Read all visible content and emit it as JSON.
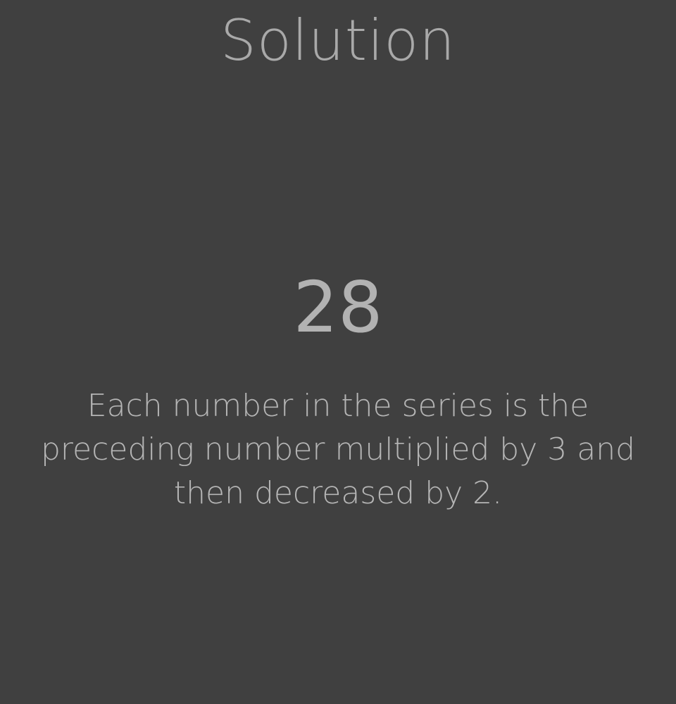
{
  "solution": {
    "title": "Solution",
    "answer": "28",
    "explanation": "Each number in the series is the preceding number multiplied by 3 and then decreased by 2."
  },
  "colors": {
    "background": "#404040",
    "text": "#b0b0b0"
  }
}
